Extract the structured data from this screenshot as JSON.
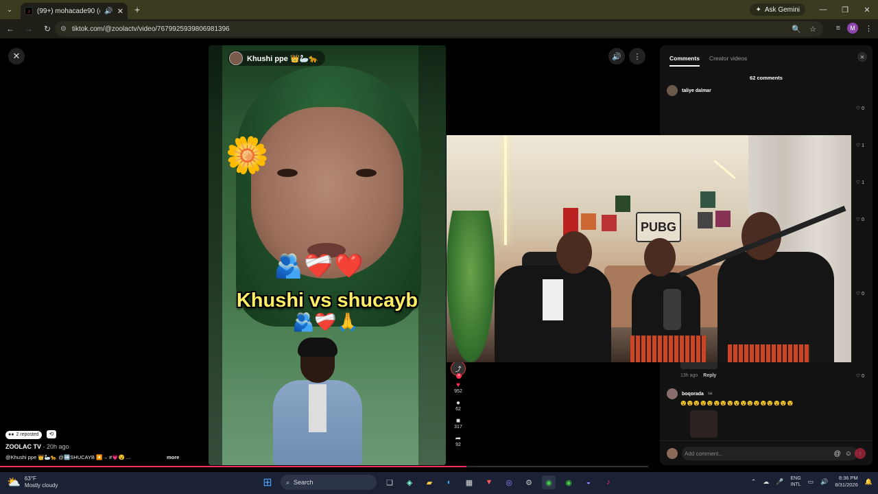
{
  "browser": {
    "tab_title": "(99+) mohacade90 (@moh...",
    "gemini_label": "Ask Gemini",
    "url": "tiktok.com/@zoolactv/video/7679925939806981396"
  },
  "video": {
    "author": "Khushi ppe 👑🦢🐆",
    "caption": "Khushi vs shucayb",
    "hearts_top": "🫂❤️‍🩹❤️",
    "hearts_bottom": "🫂❤️‍🩹🙏",
    "flower": "🌼"
  },
  "actions": {
    "likes": "952",
    "comments": "62",
    "saves": "317",
    "shares": "92"
  },
  "info": {
    "repost_label": "2 reposted",
    "channel": "ZOOLAC TV",
    "ago": "· 20h ago",
    "description": "@Khushi ppe 👑🦢🐆 @➡️SHUCAYB ◀️→ #💗😵 ...",
    "more": "more"
  },
  "comments": {
    "tab_comments": "Comments",
    "tab_creator": "Creator videos",
    "count": "62 comments",
    "first_user": "taliye dalmar",
    "likes_list": [
      "0",
      "1",
      "1",
      "0",
      "0"
    ],
    "reply_meta": "13h ago",
    "reply_label": "Reply",
    "reply_likes": "0",
    "second_user": "boqorada",
    "second_user_badge": "sa",
    "emoji_line": "😵😵😵😵😵😵😵😵😵😵😵😵😵😵😵😵😵",
    "input_placeholder": "Add comment..."
  },
  "cam": {
    "sign": "PUBG"
  },
  "taskbar": {
    "temp": "63°F",
    "weather": "Mostly cloudy",
    "search": "Search",
    "lang_top": "ENG",
    "lang_bottom": "INTL",
    "time": "8:36 PM",
    "date": "8/31/2026"
  },
  "colors": {
    "accent": "#fe2c55",
    "tabbar": "#3b3b1f",
    "taskbar": "#1b2236"
  }
}
